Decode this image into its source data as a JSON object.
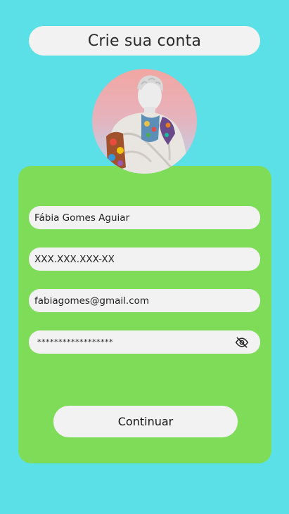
{
  "header": {
    "title": "Crie sua conta"
  },
  "profile": {
    "avatar_icon": "statue-with-tattoos-avatar"
  },
  "form": {
    "name_value": "Fábia Gomes Aguiar",
    "cpf_value": "XXX.XXX.XXX-XX",
    "email_value": "fabiagomes@gmail.com",
    "password_value": "******************",
    "password_toggle_icon": "eye-slash-icon"
  },
  "actions": {
    "continue_label": "Continuar"
  },
  "colors": {
    "background": "#5ae0e6",
    "card": "#7edc59",
    "field": "#f2f2f2"
  }
}
